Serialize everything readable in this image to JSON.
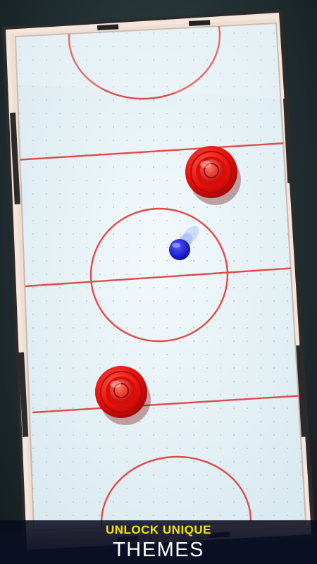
{
  "colors": {
    "frame": "#f3e3d8",
    "ice": "#e8f3f7",
    "line": "#e04a4a",
    "mallet": "#e8110c",
    "puck": "#1a1dcc",
    "banner_yellow": "#f6e20a"
  },
  "icons": {
    "mallet": "red-mallet-icon",
    "puck": "blue-puck-icon"
  },
  "banner": {
    "line1": "UNLOCK UNIQUE",
    "line2": "THEMES"
  }
}
